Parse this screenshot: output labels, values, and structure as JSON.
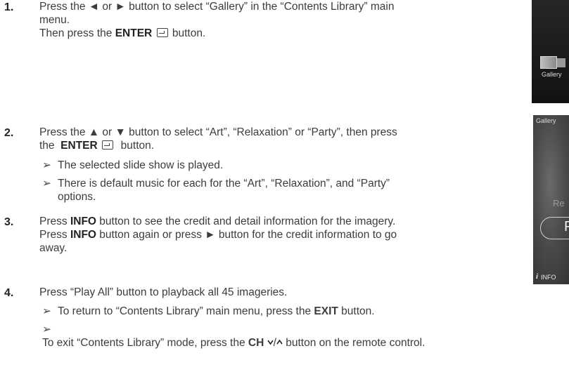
{
  "steps": [
    {
      "number": "1.",
      "lines": [
        "Press the ◄ or ► button to select “Gallery” in the “Contents Library” main",
        "menu."
      ],
      "line3_prefix": "Then press the ",
      "line3_bold": "ENTER",
      "line3_suffix": " button."
    },
    {
      "number": "2.",
      "line1": "Press the ▲ or ▼ button to select “Art”, “Relaxation” or “Party”, then press",
      "line2_prefix": "the ",
      "line2_bold": "ENTER",
      "line2_suffix": " button.",
      "subs": [
        "The selected slide show is played.",
        "There is default music for each for the “Art”, “Relaxation”, and “Party”",
        "options."
      ]
    },
    {
      "number": "3.",
      "l1_prefix": "Press ",
      "l1_bold": "INFO",
      "l1_suffix": " button to see the credit and detail information for the imagery.",
      "l2_prefix": "Press ",
      "l2_bold": "INFO",
      "l2_suffix": " button again or press ► button for the credit information to go",
      "l3": "away."
    },
    {
      "number": "4.",
      "line1": "Press “Play All” button to playback all 45 imageries.",
      "sub1_prefix": "To return to “Contents Library” main menu, press the ",
      "sub1_bold": "EXIT",
      "sub1_suffix": " button.",
      "sub2_prefix": "To exit “Contents Library” mode, press the ",
      "sub2_bold": "CH",
      "sub2_suffix": " button on the remote control."
    }
  ],
  "sub_arrow": "➢",
  "screens": {
    "gallery_thumb_label": "Gallery",
    "gallery_header": "Gallery",
    "faded_text": "Re",
    "play_letter": "P",
    "info_i": "i",
    "info_label": "INFO"
  }
}
